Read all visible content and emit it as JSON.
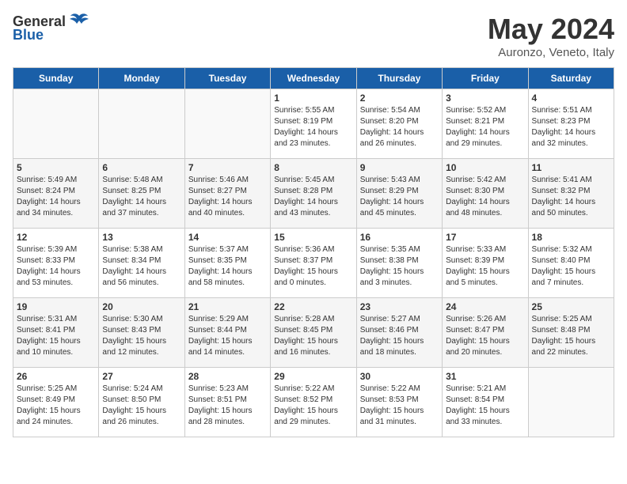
{
  "header": {
    "logo_general": "General",
    "logo_blue": "Blue",
    "title": "May 2024",
    "subtitle": "Auronzo, Veneto, Italy"
  },
  "days_of_week": [
    "Sunday",
    "Monday",
    "Tuesday",
    "Wednesday",
    "Thursday",
    "Friday",
    "Saturday"
  ],
  "weeks": [
    [
      {
        "day": "",
        "sunrise": "",
        "sunset": "",
        "daylight": ""
      },
      {
        "day": "",
        "sunrise": "",
        "sunset": "",
        "daylight": ""
      },
      {
        "day": "",
        "sunrise": "",
        "sunset": "",
        "daylight": ""
      },
      {
        "day": "1",
        "sunrise": "Sunrise: 5:55 AM",
        "sunset": "Sunset: 8:19 PM",
        "daylight": "Daylight: 14 hours and 23 minutes."
      },
      {
        "day": "2",
        "sunrise": "Sunrise: 5:54 AM",
        "sunset": "Sunset: 8:20 PM",
        "daylight": "Daylight: 14 hours and 26 minutes."
      },
      {
        "day": "3",
        "sunrise": "Sunrise: 5:52 AM",
        "sunset": "Sunset: 8:21 PM",
        "daylight": "Daylight: 14 hours and 29 minutes."
      },
      {
        "day": "4",
        "sunrise": "Sunrise: 5:51 AM",
        "sunset": "Sunset: 8:23 PM",
        "daylight": "Daylight: 14 hours and 32 minutes."
      }
    ],
    [
      {
        "day": "5",
        "sunrise": "Sunrise: 5:49 AM",
        "sunset": "Sunset: 8:24 PM",
        "daylight": "Daylight: 14 hours and 34 minutes."
      },
      {
        "day": "6",
        "sunrise": "Sunrise: 5:48 AM",
        "sunset": "Sunset: 8:25 PM",
        "daylight": "Daylight: 14 hours and 37 minutes."
      },
      {
        "day": "7",
        "sunrise": "Sunrise: 5:46 AM",
        "sunset": "Sunset: 8:27 PM",
        "daylight": "Daylight: 14 hours and 40 minutes."
      },
      {
        "day": "8",
        "sunrise": "Sunrise: 5:45 AM",
        "sunset": "Sunset: 8:28 PM",
        "daylight": "Daylight: 14 hours and 43 minutes."
      },
      {
        "day": "9",
        "sunrise": "Sunrise: 5:43 AM",
        "sunset": "Sunset: 8:29 PM",
        "daylight": "Daylight: 14 hours and 45 minutes."
      },
      {
        "day": "10",
        "sunrise": "Sunrise: 5:42 AM",
        "sunset": "Sunset: 8:30 PM",
        "daylight": "Daylight: 14 hours and 48 minutes."
      },
      {
        "day": "11",
        "sunrise": "Sunrise: 5:41 AM",
        "sunset": "Sunset: 8:32 PM",
        "daylight": "Daylight: 14 hours and 50 minutes."
      }
    ],
    [
      {
        "day": "12",
        "sunrise": "Sunrise: 5:39 AM",
        "sunset": "Sunset: 8:33 PM",
        "daylight": "Daylight: 14 hours and 53 minutes."
      },
      {
        "day": "13",
        "sunrise": "Sunrise: 5:38 AM",
        "sunset": "Sunset: 8:34 PM",
        "daylight": "Daylight: 14 hours and 56 minutes."
      },
      {
        "day": "14",
        "sunrise": "Sunrise: 5:37 AM",
        "sunset": "Sunset: 8:35 PM",
        "daylight": "Daylight: 14 hours and 58 minutes."
      },
      {
        "day": "15",
        "sunrise": "Sunrise: 5:36 AM",
        "sunset": "Sunset: 8:37 PM",
        "daylight": "Daylight: 15 hours and 0 minutes."
      },
      {
        "day": "16",
        "sunrise": "Sunrise: 5:35 AM",
        "sunset": "Sunset: 8:38 PM",
        "daylight": "Daylight: 15 hours and 3 minutes."
      },
      {
        "day": "17",
        "sunrise": "Sunrise: 5:33 AM",
        "sunset": "Sunset: 8:39 PM",
        "daylight": "Daylight: 15 hours and 5 minutes."
      },
      {
        "day": "18",
        "sunrise": "Sunrise: 5:32 AM",
        "sunset": "Sunset: 8:40 PM",
        "daylight": "Daylight: 15 hours and 7 minutes."
      }
    ],
    [
      {
        "day": "19",
        "sunrise": "Sunrise: 5:31 AM",
        "sunset": "Sunset: 8:41 PM",
        "daylight": "Daylight: 15 hours and 10 minutes."
      },
      {
        "day": "20",
        "sunrise": "Sunrise: 5:30 AM",
        "sunset": "Sunset: 8:43 PM",
        "daylight": "Daylight: 15 hours and 12 minutes."
      },
      {
        "day": "21",
        "sunrise": "Sunrise: 5:29 AM",
        "sunset": "Sunset: 8:44 PM",
        "daylight": "Daylight: 15 hours and 14 minutes."
      },
      {
        "day": "22",
        "sunrise": "Sunrise: 5:28 AM",
        "sunset": "Sunset: 8:45 PM",
        "daylight": "Daylight: 15 hours and 16 minutes."
      },
      {
        "day": "23",
        "sunrise": "Sunrise: 5:27 AM",
        "sunset": "Sunset: 8:46 PM",
        "daylight": "Daylight: 15 hours and 18 minutes."
      },
      {
        "day": "24",
        "sunrise": "Sunrise: 5:26 AM",
        "sunset": "Sunset: 8:47 PM",
        "daylight": "Daylight: 15 hours and 20 minutes."
      },
      {
        "day": "25",
        "sunrise": "Sunrise: 5:25 AM",
        "sunset": "Sunset: 8:48 PM",
        "daylight": "Daylight: 15 hours and 22 minutes."
      }
    ],
    [
      {
        "day": "26",
        "sunrise": "Sunrise: 5:25 AM",
        "sunset": "Sunset: 8:49 PM",
        "daylight": "Daylight: 15 hours and 24 minutes."
      },
      {
        "day": "27",
        "sunrise": "Sunrise: 5:24 AM",
        "sunset": "Sunset: 8:50 PM",
        "daylight": "Daylight: 15 hours and 26 minutes."
      },
      {
        "day": "28",
        "sunrise": "Sunrise: 5:23 AM",
        "sunset": "Sunset: 8:51 PM",
        "daylight": "Daylight: 15 hours and 28 minutes."
      },
      {
        "day": "29",
        "sunrise": "Sunrise: 5:22 AM",
        "sunset": "Sunset: 8:52 PM",
        "daylight": "Daylight: 15 hours and 29 minutes."
      },
      {
        "day": "30",
        "sunrise": "Sunrise: 5:22 AM",
        "sunset": "Sunset: 8:53 PM",
        "daylight": "Daylight: 15 hours and 31 minutes."
      },
      {
        "day": "31",
        "sunrise": "Sunrise: 5:21 AM",
        "sunset": "Sunset: 8:54 PM",
        "daylight": "Daylight: 15 hours and 33 minutes."
      },
      {
        "day": "",
        "sunrise": "",
        "sunset": "",
        "daylight": ""
      }
    ]
  ]
}
